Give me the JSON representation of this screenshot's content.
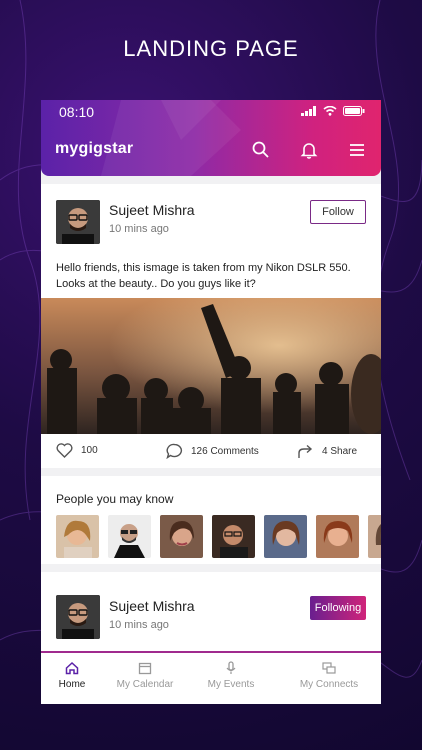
{
  "page_label": "LANDING PAGE",
  "status": {
    "time": "08:10"
  },
  "app": {
    "logo": "mygigstar"
  },
  "post1": {
    "author": "Sujeet Mishra",
    "time": "10 mins ago",
    "follow_label": "Follow",
    "text": "Hello friends, this ismage is taken from my Nikon DSLR 550. Looks at the beauty.. Do you guys like it?",
    "likes": "100",
    "comments": "126 Comments",
    "shares": "4 Share"
  },
  "people_section": {
    "title": "People you may know"
  },
  "post2": {
    "author": "Sujeet Mishra",
    "time": "10 mins ago",
    "follow_label": "Following"
  },
  "tabs": [
    {
      "label": "Home",
      "icon": "home-icon"
    },
    {
      "label": "My Calendar",
      "icon": "calendar-icon"
    },
    {
      "label": "My Events",
      "icon": "microphone-icon"
    },
    {
      "label": "My Connects",
      "icon": "chat-icon"
    }
  ],
  "colors": {
    "accent_purple": "#5b22a8",
    "accent_pink": "#e0246e",
    "background": "#1e0b45"
  }
}
